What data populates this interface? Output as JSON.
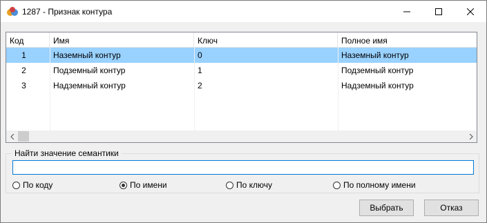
{
  "window": {
    "title": "1287 -  Признак контура"
  },
  "table": {
    "columns": [
      "Код",
      "Имя",
      "Ключ",
      "Полное имя"
    ],
    "rows": [
      {
        "code": "1",
        "name": "Наземный контур",
        "key": "0",
        "full": "Наземный контур",
        "selected": true
      },
      {
        "code": "2",
        "name": "Подземный контур",
        "key": "1",
        "full": "Подземный контур",
        "selected": false
      },
      {
        "code": "3",
        "name": "Надземный контур",
        "key": "2",
        "full": "Надземный контур",
        "selected": false
      }
    ]
  },
  "search": {
    "group_label": "Найти значение семантики",
    "value": "",
    "options": [
      {
        "label": "По коду",
        "checked": false
      },
      {
        "label": "По имени",
        "checked": true
      },
      {
        "label": "По ключу",
        "checked": false
      },
      {
        "label": "По полному имени",
        "checked": false
      }
    ]
  },
  "buttons": {
    "select": "Выбрать",
    "cancel": "Отказ"
  },
  "colors": {
    "selection": "#99d1ff",
    "focus": "#0078d7"
  }
}
